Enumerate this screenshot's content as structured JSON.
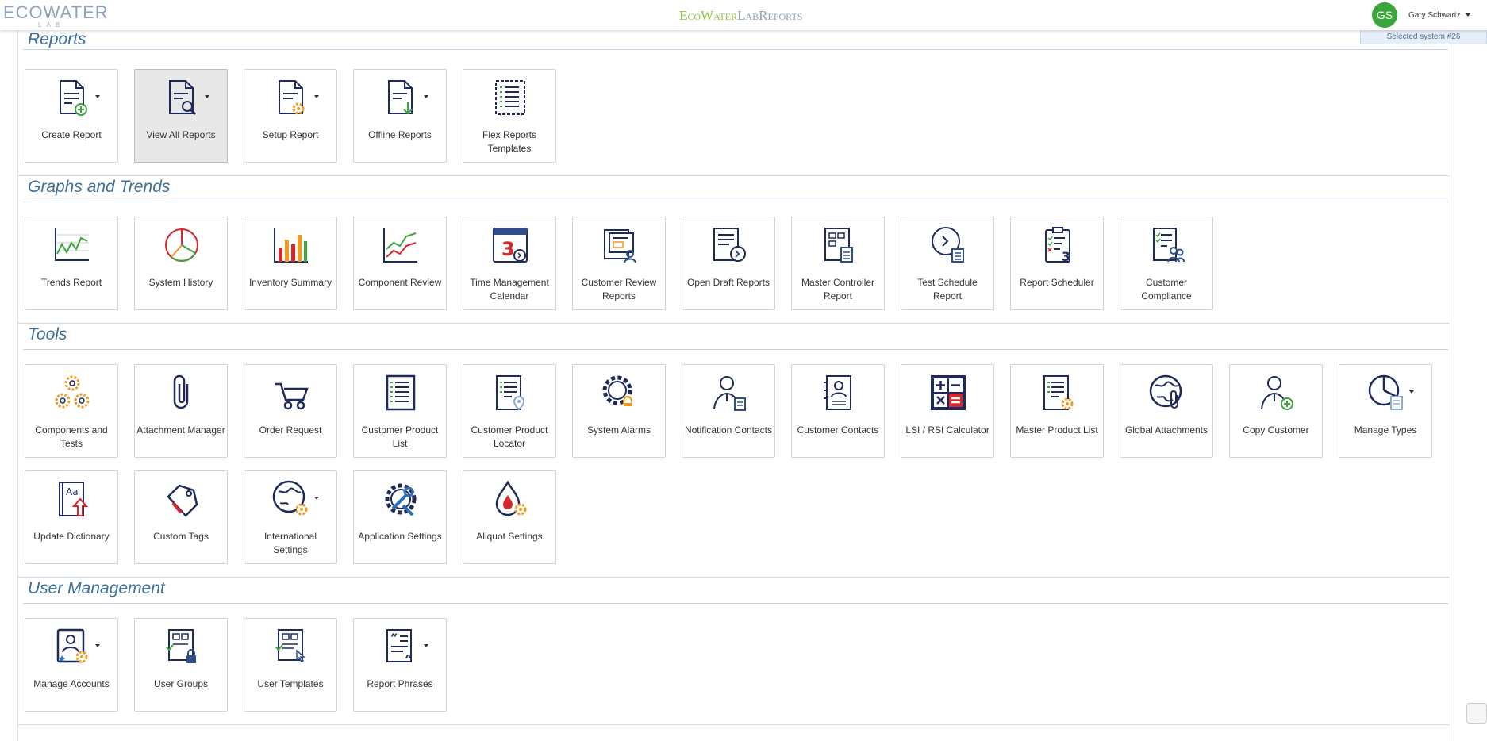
{
  "header": {
    "logo_text": "ECOWATER",
    "logo_sub": "LAB",
    "brand_eco": "EcoWater",
    "brand_rest": "LabReports",
    "avatar_initials": "GS",
    "user_name": "Gary Schwartz",
    "selected_system": "Selected system #26"
  },
  "sections": {
    "reports": {
      "title": "Reports",
      "items": [
        "Create Report",
        "View All Reports",
        "Setup Report",
        "Offline Reports",
        "Flex Reports Templates"
      ]
    },
    "graphs": {
      "title": "Graphs and Trends",
      "items": [
        "Trends Report",
        "System History",
        "Inventory Summary",
        "Component Review",
        "Time Management Calendar",
        "Customer Review Reports",
        "Open Draft Reports",
        "Master Controller Report",
        "Test Schedule Report",
        "Report Scheduler",
        "Customer Compliance"
      ]
    },
    "tools": {
      "title": "Tools",
      "items": [
        "Components and Tests",
        "Attachment Manager",
        "Order Request",
        "Customer Product List",
        "Customer Product Locator",
        "System Alarms",
        "Notification Contacts",
        "Customer Contacts",
        "LSI / RSI Calculator",
        "Master Product List",
        "Global Attachments",
        "Copy Customer",
        "Manage Types",
        "Update Dictionary",
        "Custom Tags",
        "International Settings",
        "Application Settings",
        "Aliquot Settings"
      ]
    },
    "users": {
      "title": "User Management",
      "items": [
        "Manage Accounts",
        "User Groups",
        "User Templates",
        "Report Phrases"
      ]
    }
  },
  "colors": {
    "section_title": "#3d6f9c",
    "icon_navy": "#1f2a5c",
    "icon_orange": "#f39a1e",
    "icon_green": "#3aa53a",
    "icon_red": "#d8262f"
  }
}
